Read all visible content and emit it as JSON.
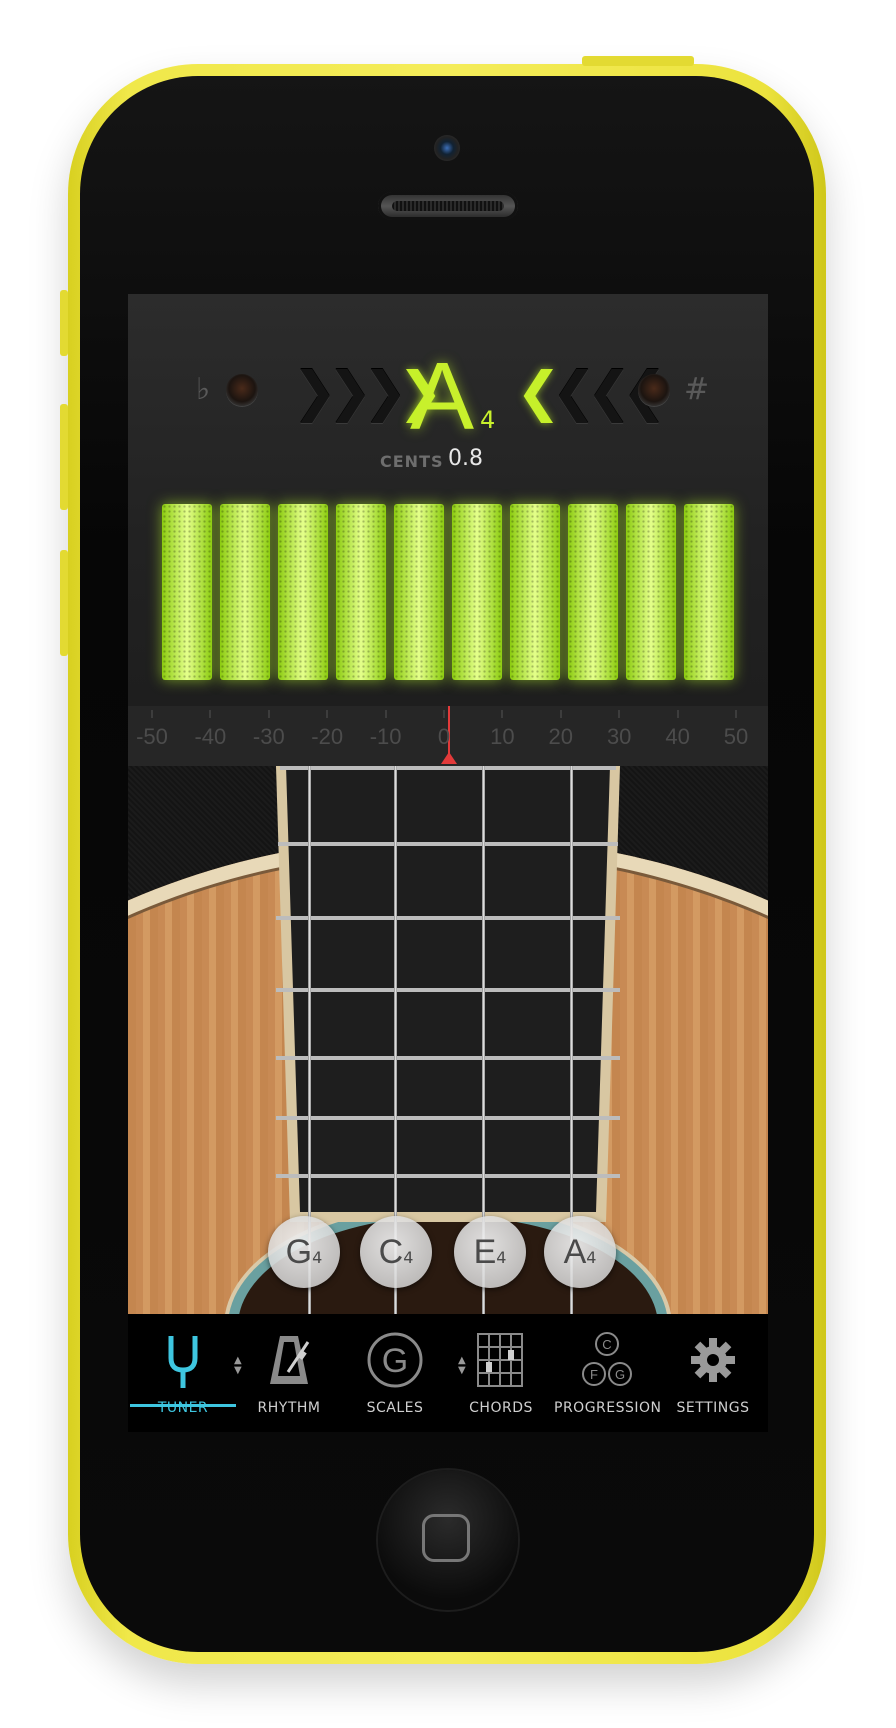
{
  "tuner": {
    "flat_symbol": "♭",
    "sharp_symbol": "#",
    "note": "A",
    "octave": "4",
    "cents_label": "CENTS",
    "cents_value": "0.8",
    "level_bars_lit": 10,
    "accent_color": "#c8f02c"
  },
  "scale": {
    "labels": [
      "-50",
      "-40",
      "-30",
      "-20",
      "-10",
      "0",
      "10",
      "20",
      "30",
      "40",
      "50"
    ],
    "needle_value": 0.8,
    "needle_color": "#e23a3a"
  },
  "strings": [
    {
      "note": "G",
      "octave": "4"
    },
    {
      "note": "C",
      "octave": "4"
    },
    {
      "note": "E",
      "octave": "4"
    },
    {
      "note": "A",
      "octave": "4"
    }
  ],
  "tabs": [
    {
      "label": "TUNER",
      "icon": "tuning-fork-icon",
      "active": true
    },
    {
      "label": "RHYTHM",
      "icon": "metronome-icon",
      "active": false
    },
    {
      "label": "SCALES",
      "icon": "scale-g-icon",
      "active": false
    },
    {
      "label": "CHORDS",
      "icon": "chord-diagram-icon",
      "active": false
    },
    {
      "label": "PROGRESSION",
      "icon": "progression-icon",
      "active": false
    },
    {
      "label": "SETTINGS",
      "icon": "gear-icon",
      "active": false
    }
  ],
  "tab_accent_color": "#3ec6e0"
}
